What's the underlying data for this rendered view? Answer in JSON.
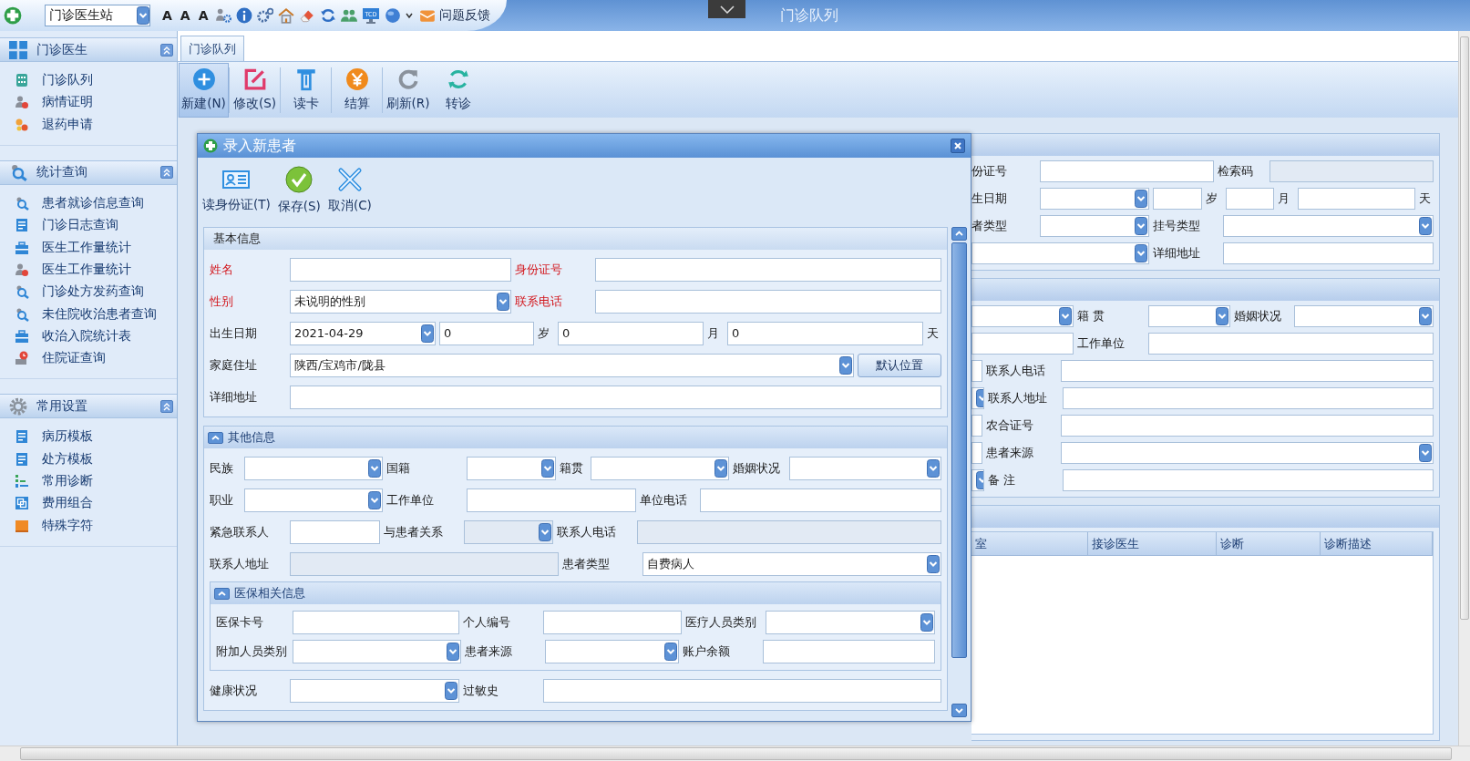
{
  "top_bar": {
    "station": "门诊医生站",
    "font_buttons": [
      "A",
      "A",
      "A"
    ],
    "monitor_label": "TCD",
    "feedback": "问题反馈",
    "title": "门诊队列"
  },
  "sidebar": [
    {
      "title": "门诊医生",
      "expanded": true,
      "items": [
        "门诊队列",
        "病情证明",
        "退药申请"
      ]
    },
    {
      "title": "统计查询",
      "expanded": true,
      "items": [
        "患者就诊信息查询",
        "门诊日志查询",
        "医生工作量统计",
        "医生工作量统计",
        "门诊处方发药查询",
        "未住院收治患者查询",
        "收治入院统计表",
        "住院证查询"
      ]
    },
    {
      "title": "常用设置",
      "expanded": true,
      "items": [
        "病历模板",
        "处方模板",
        "常用诊断",
        "费用组合",
        "特殊字符"
      ]
    }
  ],
  "tabs": [
    {
      "label": "门诊队列",
      "selected": true
    }
  ],
  "toolbar": [
    {
      "label": "新建(N)",
      "selected": true
    },
    {
      "label": "修改(S)",
      "selected": false
    },
    {
      "label": "读卡",
      "selected": false
    },
    {
      "label": "结算",
      "selected": false
    },
    {
      "label": "刷新(R)",
      "selected": false
    },
    {
      "label": "转诊",
      "selected": false
    }
  ],
  "background_form": {
    "panels": [
      {
        "cells": [
          {
            "kind": "label",
            "text": "份证号"
          },
          {
            "kind": "field",
            "disabled": false
          },
          {
            "kind": "label",
            "text": "检索码"
          },
          {
            "kind": "field",
            "disabled": true
          },
          {
            "kind": "label",
            "text": "生日期"
          },
          {
            "kind": "dropdown",
            "disabled": false
          },
          {
            "kind": "field",
            "disabled": false
          },
          {
            "kind": "label",
            "text": "岁"
          },
          {
            "kind": "field",
            "disabled": false
          },
          {
            "kind": "label",
            "text": "月"
          },
          {
            "kind": "field",
            "disabled": false
          },
          {
            "kind": "label",
            "text": "天"
          },
          {
            "kind": "label",
            "text": "者类型"
          },
          {
            "kind": "dropdown",
            "disabled": false
          },
          {
            "kind": "label",
            "text": "挂号类型"
          },
          {
            "kind": "dropdown",
            "disabled": false
          },
          {
            "kind": "dropdown",
            "disabled": false
          },
          {
            "kind": "label",
            "text": "详细地址"
          },
          {
            "kind": "field",
            "disabled": false
          }
        ]
      },
      {
        "cells": [
          {
            "kind": "dropdown",
            "disabled": false
          },
          {
            "kind": "label",
            "text": "籍 贯"
          },
          {
            "kind": "dropdown",
            "disabled": false
          },
          {
            "kind": "label",
            "text": "婚姻状况"
          },
          {
            "kind": "dropdown",
            "disabled": false
          },
          {
            "kind": "field",
            "disabled": false
          },
          {
            "kind": "label",
            "text": "工作单位"
          },
          {
            "kind": "field",
            "disabled": false
          },
          {
            "kind": "field",
            "disabled": false
          },
          {
            "kind": "label",
            "text": "联系人电话"
          },
          {
            "kind": "field",
            "disabled": false
          },
          {
            "kind": "dropdown",
            "disabled": false
          },
          {
            "kind": "label",
            "text": "联系人地址"
          },
          {
            "kind": "field",
            "disabled": false
          },
          {
            "kind": "field",
            "disabled": false
          },
          {
            "kind": "label",
            "text": "农合证号"
          },
          {
            "kind": "field",
            "disabled": false
          },
          {
            "kind": "field",
            "disabled": false
          },
          {
            "kind": "label",
            "text": "患者来源"
          },
          {
            "kind": "dropdown",
            "disabled": false
          },
          {
            "kind": "dropdown",
            "disabled": false
          },
          {
            "kind": "label",
            "text": "备 注"
          },
          {
            "kind": "field",
            "disabled": false
          }
        ]
      }
    ],
    "table": {
      "columns": [
        "室",
        "接诊医生",
        "诊断",
        "诊断描述"
      ]
    }
  },
  "dialog": {
    "title": "录入新患者",
    "toolbar": [
      "读身份证(T)",
      "保存(S)",
      "取消(C)"
    ],
    "sections": [
      {
        "title": "基本信息",
        "collapsible": false,
        "cells": [
          {
            "kind": "label",
            "text": "姓名",
            "required": true
          },
          {
            "kind": "field",
            "disabled": false
          },
          {
            "kind": "label",
            "text": "身份证号",
            "required": true
          },
          {
            "kind": "field",
            "disabled": false
          },
          {
            "kind": "label",
            "text": "性别",
            "required": true
          },
          {
            "kind": "dropdown",
            "value": "未说明的性别",
            "disabled": false
          },
          {
            "kind": "label",
            "text": "联系电话",
            "required": true
          },
          {
            "kind": "field",
            "disabled": false
          },
          {
            "kind": "label",
            "text": "出生日期",
            "required": false
          },
          {
            "kind": "dropdown",
            "value": "2021-04-29",
            "disabled": false
          },
          {
            "kind": "field",
            "value": "0",
            "disabled": false
          },
          {
            "kind": "label",
            "text": "岁",
            "required": false
          },
          {
            "kind": "field",
            "value": "0",
            "disabled": false
          },
          {
            "kind": "label",
            "text": "月",
            "required": false
          },
          {
            "kind": "field",
            "value": "0",
            "disabled": false
          },
          {
            "kind": "label",
            "text": "天",
            "required": false
          },
          {
            "kind": "label",
            "text": "家庭住址",
            "required": false
          },
          {
            "kind": "dropdown",
            "value": "陕西/宝鸡市/陇县",
            "disabled": false
          },
          {
            "kind": "button",
            "text": "默认位置"
          },
          {
            "kind": "label",
            "text": "详细地址",
            "required": false
          },
          {
            "kind": "field",
            "disabled": false
          }
        ]
      },
      {
        "title": "其他信息",
        "collapsible": true,
        "expanded": true,
        "cells": [
          {
            "kind": "label",
            "text": "民族",
            "required": false
          },
          {
            "kind": "dropdown",
            "disabled": false
          },
          {
            "kind": "label",
            "text": "国籍",
            "required": false
          },
          {
            "kind": "dropdown",
            "disabled": false
          },
          {
            "kind": "label",
            "text": "籍贯",
            "required": false
          },
          {
            "kind": "dropdown",
            "disabled": false
          },
          {
            "kind": "label",
            "text": "婚姻状况",
            "required": false
          },
          {
            "kind": "dropdown",
            "disabled": false
          },
          {
            "kind": "label",
            "text": "职业",
            "required": false
          },
          {
            "kind": "dropdown",
            "disabled": false
          },
          {
            "kind": "label",
            "text": "工作单位",
            "required": false
          },
          {
            "kind": "field",
            "disabled": false
          },
          {
            "kind": "label",
            "text": "单位电话",
            "required": false
          },
          {
            "kind": "field",
            "disabled": false
          },
          {
            "kind": "label",
            "text": "紧急联系人",
            "required": false
          },
          {
            "kind": "field",
            "disabled": false
          },
          {
            "kind": "label",
            "text": "与患者关系",
            "required": false
          },
          {
            "kind": "dropdown",
            "disabled": true
          },
          {
            "kind": "label",
            "text": "联系人电话",
            "required": false
          },
          {
            "kind": "field",
            "disabled": true
          },
          {
            "kind": "label",
            "text": "联系人地址",
            "required": false
          },
          {
            "kind": "field",
            "disabled": true
          },
          {
            "kind": "label",
            "text": "患者类型",
            "required": false
          },
          {
            "kind": "dropdown",
            "value": "自费病人",
            "disabled": false
          }
        ],
        "subsection": {
          "title": "医保相关信息",
          "expanded": true,
          "cells": [
            {
              "kind": "label",
              "text": "医保卡号",
              "required": false
            },
            {
              "kind": "field",
              "disabled": false
            },
            {
              "kind": "label",
              "text": "个人编号",
              "required": false
            },
            {
              "kind": "field",
              "disabled": false
            },
            {
              "kind": "label",
              "text": "医疗人员类别",
              "required": false
            },
            {
              "kind": "dropdown",
              "disabled": false
            },
            {
              "kind": "label",
              "text": "附加人员类别",
              "required": false
            },
            {
              "kind": "dropdown",
              "disabled": false
            },
            {
              "kind": "label",
              "text": "患者来源",
              "required": false
            },
            {
              "kind": "dropdown",
              "disabled": false
            },
            {
              "kind": "label",
              "text": "账户余额",
              "required": false
            },
            {
              "kind": "field",
              "disabled": false
            }
          ]
        },
        "after_cells": [
          {
            "kind": "label",
            "text": "健康状况",
            "required": false
          },
          {
            "kind": "dropdown",
            "disabled": false
          },
          {
            "kind": "label",
            "text": "过敏史",
            "required": false
          },
          {
            "kind": "field",
            "disabled": false
          }
        ]
      }
    ]
  }
}
